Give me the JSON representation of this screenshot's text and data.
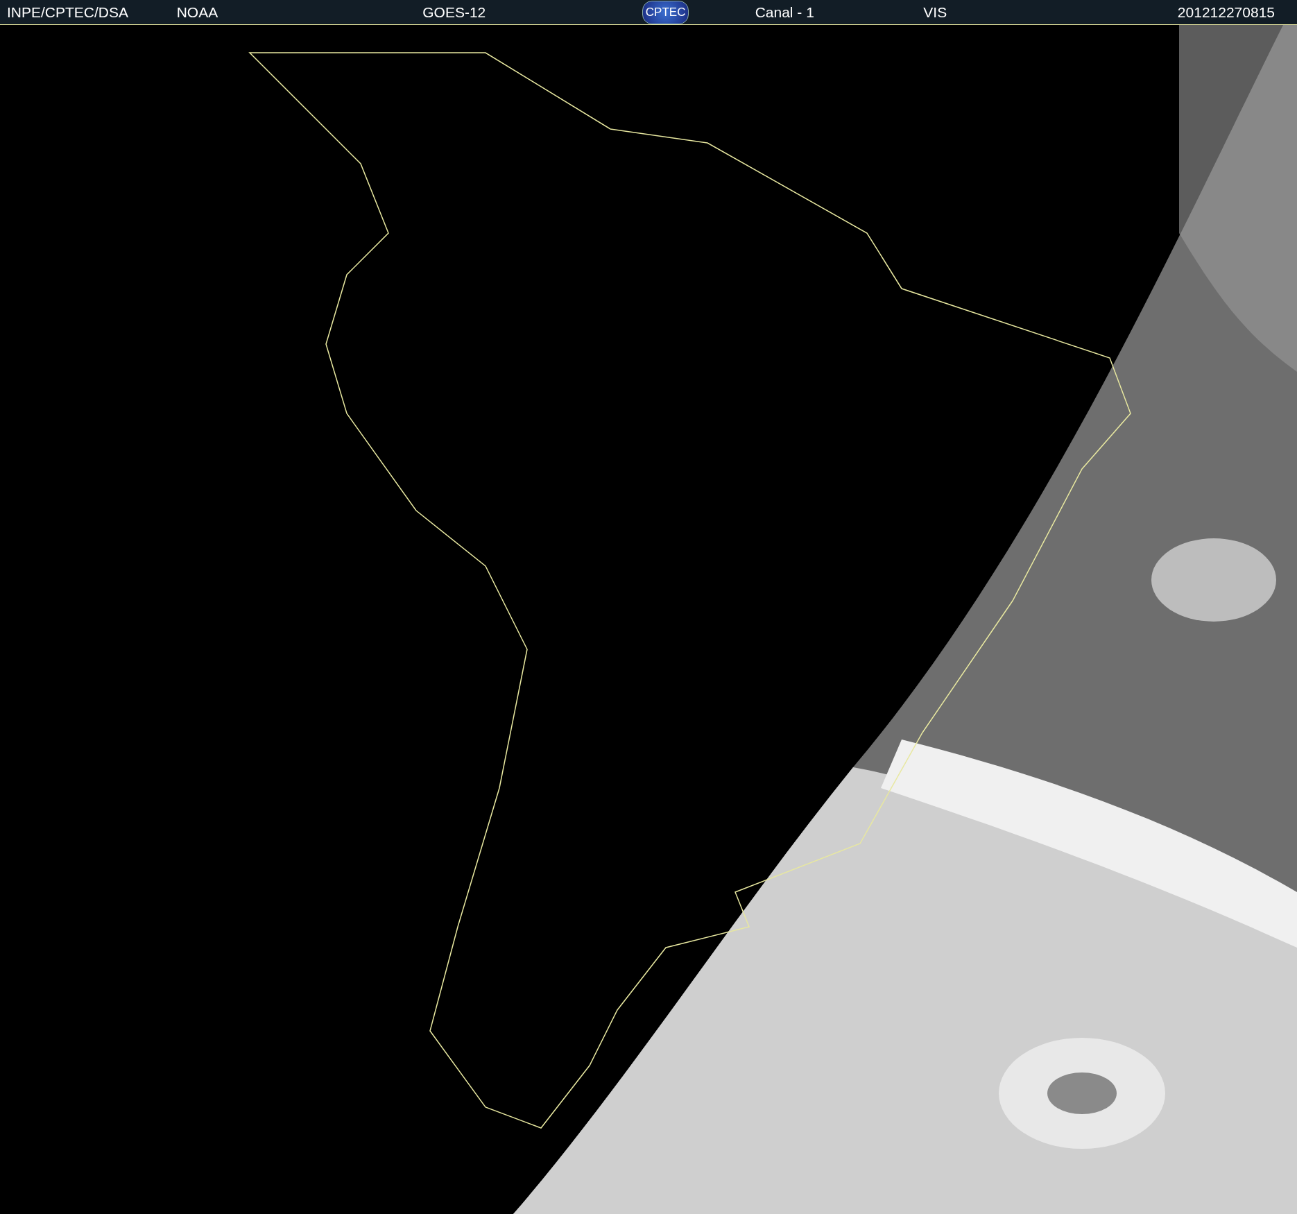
{
  "header": {
    "items": [
      {
        "text": "INPE/CPTEC/DSA"
      },
      {
        "text": "NOAA"
      },
      {
        "text": "GOES-12"
      },
      {
        "text": "CPTEC",
        "kind": "logo"
      },
      {
        "text": "Canal - 1"
      },
      {
        "text": "VIS"
      },
      {
        "text": "201212270815"
      }
    ]
  }
}
